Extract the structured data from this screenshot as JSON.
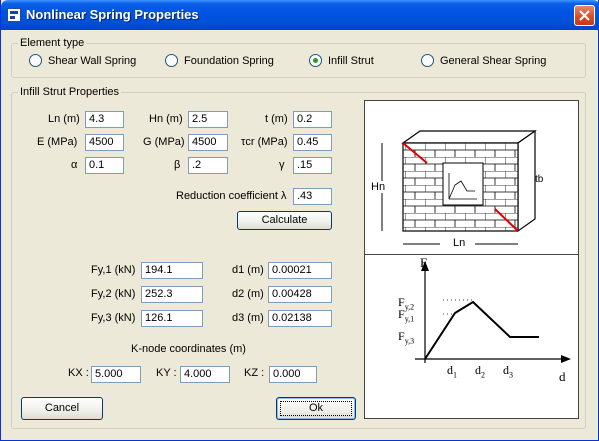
{
  "window": {
    "title": "Nonlinear Spring Properties"
  },
  "element_type": {
    "legend": "Element type",
    "options": [
      {
        "label": "Shear Wall Spring",
        "checked": false
      },
      {
        "label": "Foundation Spring",
        "checked": false
      },
      {
        "label": "Infill Strut",
        "checked": true
      },
      {
        "label": "General Shear Spring",
        "checked": false
      }
    ]
  },
  "infill": {
    "legend": "Infill Strut Properties",
    "ln_label": "Ln (m)",
    "ln_value": "4.3",
    "hn_label": "Hn (m)",
    "hn_value": "2.5",
    "t_label": "t (m)",
    "t_value": "0.2",
    "e_label": "E (MPa)",
    "e_value": "4500",
    "g_label": "G (MPa)",
    "g_value": "4500",
    "tcr_label": "τcr (MPa)",
    "tcr_value": "0.45",
    "alpha_label": "α",
    "alpha_value": "0.1",
    "beta_label": "β",
    "beta_value": ".2",
    "gamma_label": "γ",
    "gamma_value": ".15",
    "reduction_label": "Reduction coefficient λ",
    "reduction_value": ".43",
    "calculate_label": "Calculate",
    "fy1_label": "Fy,1 (kN)",
    "fy1_value": "194.1",
    "fy2_label": "Fy,2 (kN)",
    "fy2_value": "252.3",
    "fy3_label": "Fy,3 (kN)",
    "fy3_value": "126.1",
    "d1_label": "d1 (m)",
    "d1_value": "0.00021",
    "d2_label": "d2 (m)",
    "d2_value": "0.00428",
    "d3_label": "d3 (m)",
    "d3_value": "0.02138",
    "knode_title": "K-node coordinates (m)",
    "kx_label": "KX :",
    "kx_value": "5.000",
    "ky_label": "KY :",
    "ky_value": "4.000",
    "kz_label": "KZ :",
    "kz_value": "0.000"
  },
  "buttons": {
    "cancel_label": "Cancel",
    "ok_label": "Ok"
  },
  "diagram": {
    "hn_label": "Hn",
    "ln_label": "Ln",
    "tb_label": "tb",
    "f_label": "F",
    "d_label": "d",
    "fy2_label": "F",
    "fy2_sub": "y,2",
    "fy1_label": "F",
    "fy1_sub": "y,1",
    "fy3_label": "F",
    "fy3_sub": "y,3",
    "d1_label": "d",
    "d1_sub": "1",
    "d2_label": "d",
    "d2_sub": "2",
    "d3_label": "d",
    "d3_sub": "3"
  },
  "colors": {
    "titlebar": "#0054e3",
    "strut": "#e00000",
    "radio_check": "#21a121"
  }
}
